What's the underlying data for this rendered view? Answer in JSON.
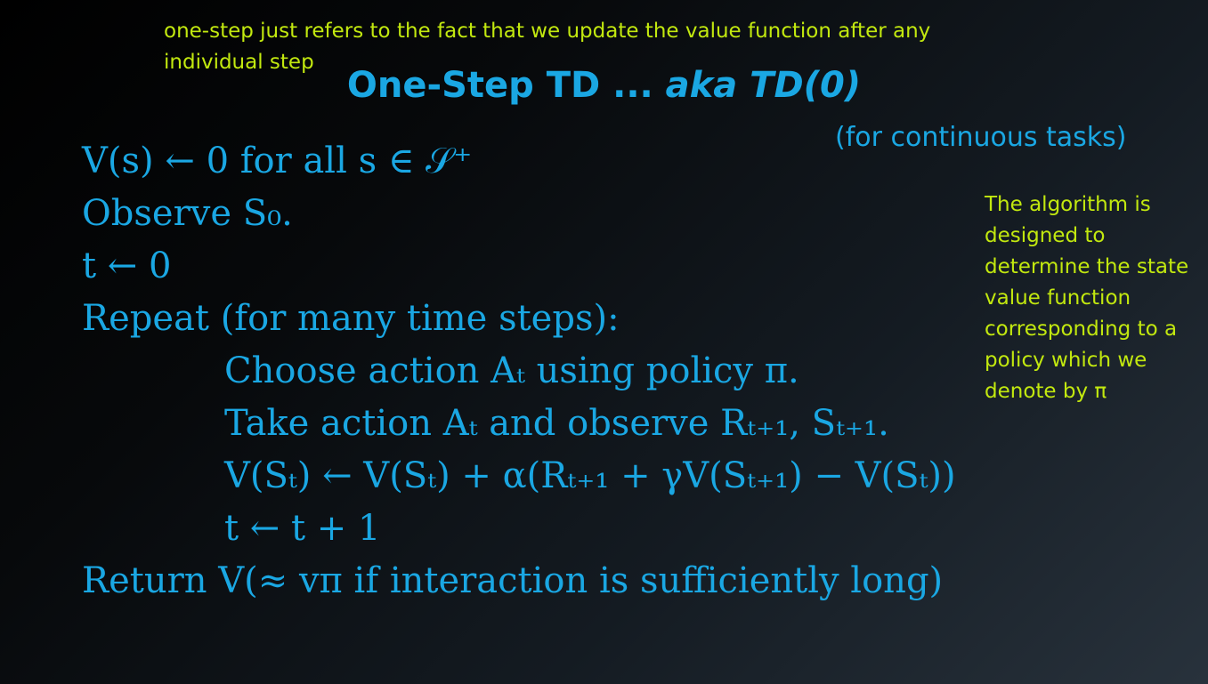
{
  "annotation_top": "one-step just refers to the fact that we update the value function after any individual step",
  "title": {
    "main": "One-Step TD ... ",
    "aka": "aka TD(0)"
  },
  "subtitle": "(for continuous tasks)",
  "annotation_side": "The algorithm is designed to determine the state value function corresponding to a policy which we denote by π",
  "algorithm": {
    "line1": "V(s) ← 0 for all s ∈ 𝒮⁺",
    "line2": "Observe S₀.",
    "line3": "t ← 0",
    "line4": "Repeat (for many time steps):",
    "line5": "Choose action Aₜ using policy π.",
    "line6": "Take action Aₜ and observe Rₜ₊₁, Sₜ₊₁.",
    "line7": "V(Sₜ) ← V(Sₜ) + α(Rₜ₊₁ + γV(Sₜ₊₁) − V(Sₜ))",
    "line8": "t ← t + 1",
    "line9": "Return V(≈ vπ if interaction is sufficiently long)"
  },
  "colors": {
    "annotation": "#c2e80f",
    "accent": "#1aa7e3",
    "background_dark": "#000000",
    "background_light": "#28323c"
  }
}
